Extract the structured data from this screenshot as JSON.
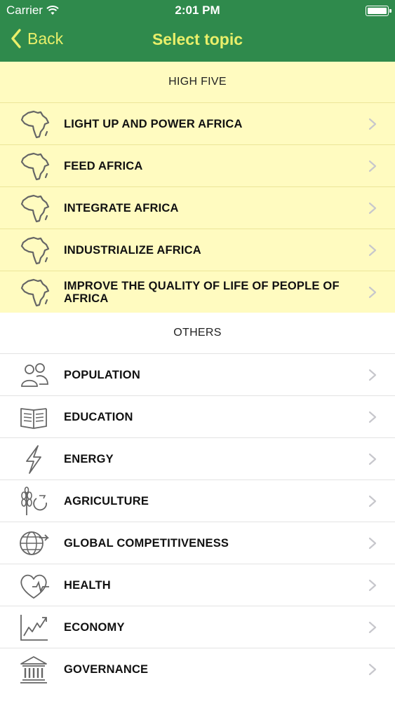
{
  "status_bar": {
    "carrier": "Carrier",
    "time": "2:01 PM",
    "battery_level": 1.0
  },
  "nav": {
    "back_label": "Back",
    "title": "Select topic"
  },
  "colors": {
    "nav_background": "#2f8a4c",
    "nav_text": "#e9ef6a",
    "high_five_background": "#fffbc0"
  },
  "high_five": {
    "header": "HIGH FIVE",
    "items": [
      {
        "label": "LIGHT UP AND POWER AFRICA",
        "icon": "africa-map-icon"
      },
      {
        "label": "FEED AFRICA",
        "icon": "africa-map-icon"
      },
      {
        "label": "INTEGRATE AFRICA",
        "icon": "africa-map-icon"
      },
      {
        "label": "INDUSTRIALIZE AFRICA",
        "icon": "africa-map-icon"
      },
      {
        "label": "IMPROVE THE QUALITY OF LIFE OF PEOPLE OF AFRICA",
        "icon": "africa-map-icon"
      }
    ]
  },
  "others": {
    "header": "OTHERS",
    "items": [
      {
        "label": "POPULATION",
        "icon": "people-icon"
      },
      {
        "label": "EDUCATION",
        "icon": "open-book-icon"
      },
      {
        "label": "ENERGY",
        "icon": "lightning-icon"
      },
      {
        "label": "AGRICULTURE",
        "icon": "wheat-icon"
      },
      {
        "label": "GLOBAL COMPETITIVENESS",
        "icon": "globe-arrow-icon"
      },
      {
        "label": "HEALTH",
        "icon": "heart-pulse-icon"
      },
      {
        "label": "ECONOMY",
        "icon": "line-chart-icon"
      },
      {
        "label": "GOVERNANCE",
        "icon": "government-building-icon"
      }
    ]
  }
}
